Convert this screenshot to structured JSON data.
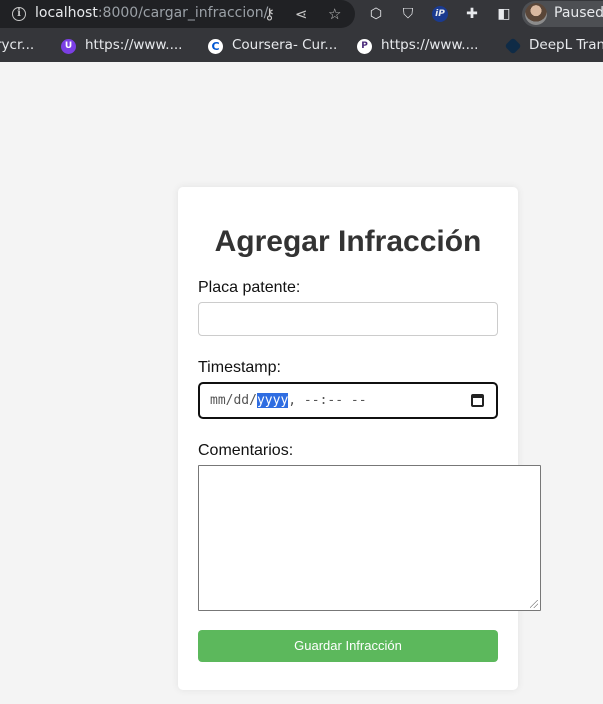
{
  "browser": {
    "url_host": "localhost",
    "url_path": ":8000/cargar_infraccion/",
    "profile_status": "Paused"
  },
  "bookmarks": [
    {
      "label": "rycr...",
      "icon": ""
    },
    {
      "label": "https://www....",
      "icon": "shield-u-icon"
    },
    {
      "label": "Coursera- Cur...",
      "icon": "coursera-icon"
    },
    {
      "label": "https://www....",
      "icon": "p-circle-icon"
    },
    {
      "label": "DeepL Tran",
      "icon": "deepl-icon"
    }
  ],
  "form": {
    "title": "Agregar Infracción",
    "placa_label": "Placa patente:",
    "placa_value": "",
    "timestamp_label": "Timestamp:",
    "timestamp_prefix": "mm/dd/",
    "timestamp_selected": "yyyy",
    "timestamp_suffix": ", --:-- --",
    "comentarios_label": "Comentarios:",
    "comentarios_value": "",
    "submit_label": "Guardar Infracción"
  },
  "colors": {
    "button": "#5cb85c",
    "page_bg": "#f4f4f4",
    "selection": "#2f6de1"
  }
}
